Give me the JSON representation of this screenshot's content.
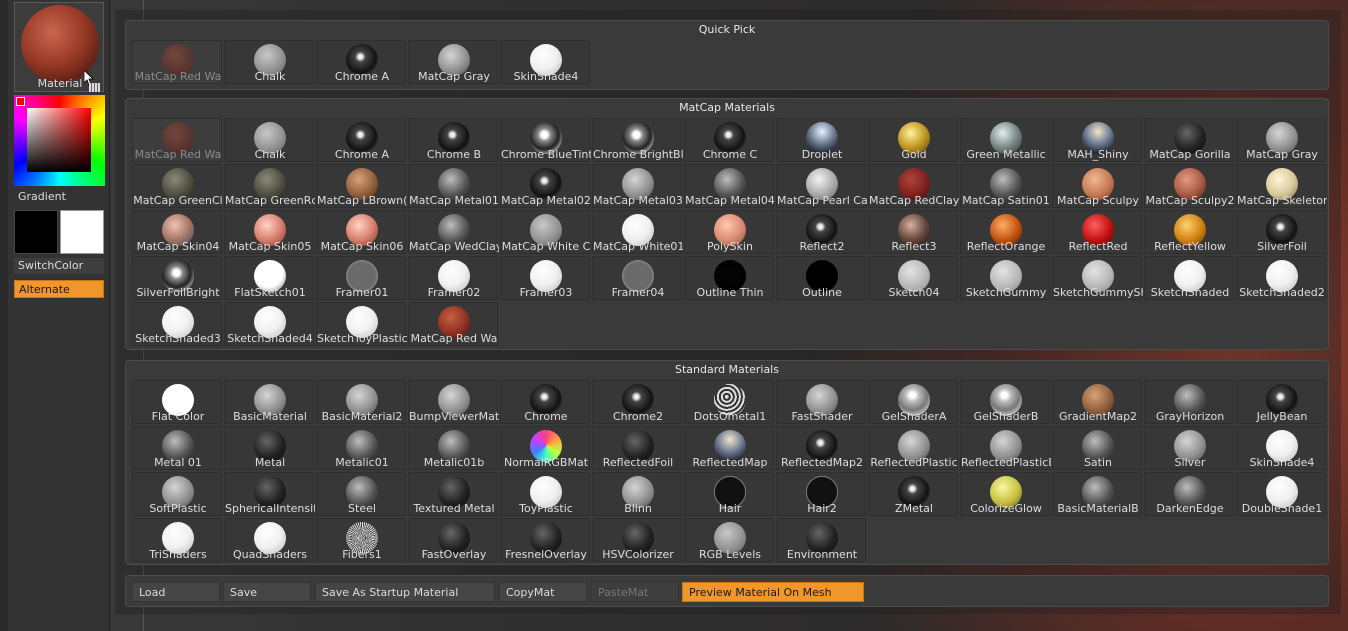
{
  "left_panel": {
    "material_label": "Material",
    "gradient_label": "Gradient",
    "switch_color": "SwitchColor",
    "alternate": "Alternate"
  },
  "colors": {
    "accent": "#f0962a",
    "panel_bg": "#3a3a3a"
  },
  "quick_pick": {
    "title": "Quick Pick",
    "items": [
      {
        "name": "MatCap Red Wax",
        "label": "MatCap Red Wa",
        "style": "redwax",
        "dim": true
      },
      {
        "name": "Chalk",
        "label": "Chalk",
        "style": "chalk"
      },
      {
        "name": "Chrome A",
        "label": "Chrome A",
        "style": "chrome"
      },
      {
        "name": "MatCap Gray",
        "label": "MatCap Gray",
        "style": "gray"
      },
      {
        "name": "SkinShade4",
        "label": "SkinShade4",
        "style": "white"
      }
    ]
  },
  "matcap": {
    "title": "MatCap Materials",
    "items": [
      {
        "label": "MatCap Red Wa",
        "style": "redwax",
        "dim": true
      },
      {
        "label": "Chalk",
        "style": "chalk"
      },
      {
        "label": "Chrome A",
        "style": "chrome"
      },
      {
        "label": "Chrome B",
        "style": "chrome"
      },
      {
        "label": "Chrome BlueTint",
        "style": "chromebright"
      },
      {
        "label": "Chrome BrightBl",
        "style": "chromebright"
      },
      {
        "label": "Chrome C",
        "style": "chrome"
      },
      {
        "label": "Droplet",
        "style": "droplet"
      },
      {
        "label": "Gold",
        "style": "gold"
      },
      {
        "label": "Green Metallic",
        "style": "greenmetal"
      },
      {
        "label": "MAH_Shiny",
        "style": "mahshiny"
      },
      {
        "label": "MatCap Gorilla",
        "style": "dark"
      },
      {
        "label": "MatCap Gray",
        "style": "gray"
      },
      {
        "label": "MatCap GreenCl",
        "style": "greenclay"
      },
      {
        "label": "MatCap GreenRc",
        "style": "greenclay"
      },
      {
        "label": "MatCap LBrown(",
        "style": "lbrown"
      },
      {
        "label": "MatCap Metal01",
        "style": "metal"
      },
      {
        "label": "MatCap Metal02",
        "style": "chrome"
      },
      {
        "label": "MatCap Metal03",
        "style": "gray"
      },
      {
        "label": "MatCap Metal04",
        "style": "metal"
      },
      {
        "label": "MatCap Pearl Ca",
        "style": "pearl"
      },
      {
        "label": "MatCap RedClay",
        "style": "redclay"
      },
      {
        "label": "MatCap Satin01",
        "style": "metal"
      },
      {
        "label": "MatCap Sculpy",
        "style": "sculpy"
      },
      {
        "label": "MatCap Sculpy2",
        "style": "sculpy2"
      },
      {
        "label": "MatCap Skeletor",
        "style": "skeleton"
      },
      {
        "label": "MatCap Skin04",
        "style": "skin04"
      },
      {
        "label": "MatCap Skin05",
        "style": "skin05"
      },
      {
        "label": "MatCap Skin06",
        "style": "skin05"
      },
      {
        "label": "MatCap WedClay",
        "style": "metal"
      },
      {
        "label": "MatCap White C",
        "style": "chalk"
      },
      {
        "label": "MatCap White01",
        "style": "white"
      },
      {
        "label": "PolySkin",
        "style": "polyskin"
      },
      {
        "label": "Reflect2",
        "style": "chrome"
      },
      {
        "label": "Reflect3",
        "style": "reflect3"
      },
      {
        "label": "ReflectOrange",
        "style": "orange"
      },
      {
        "label": "ReflectRed",
        "style": "red"
      },
      {
        "label": "ReflectYellow",
        "style": "yellow"
      },
      {
        "label": "SilverFoil",
        "style": "chrome"
      },
      {
        "label": "SilverFoilBright",
        "style": "chromebright"
      },
      {
        "label": "FlatSketch01",
        "style": "flatsketch"
      },
      {
        "label": "Framer01",
        "style": "framer"
      },
      {
        "label": "Framer02",
        "style": "white"
      },
      {
        "label": "Framer03",
        "style": "white"
      },
      {
        "label": "Framer04",
        "style": "framer"
      },
      {
        "label": "Outline Thin",
        "style": "black"
      },
      {
        "label": "Outline",
        "style": "outline"
      },
      {
        "label": "Sketch04",
        "style": "sketch"
      },
      {
        "label": "SketchGummy",
        "style": "sketch"
      },
      {
        "label": "SketchGummySh",
        "style": "sketch"
      },
      {
        "label": "SketchShaded",
        "style": "white"
      },
      {
        "label": "SketchShaded2",
        "style": "white"
      },
      {
        "label": "SketchShaded3",
        "style": "white"
      },
      {
        "label": "SketchShaded4",
        "style": "white"
      },
      {
        "label": "SketchToyPlastic",
        "style": "white"
      },
      {
        "label": "MatCap Red Wa",
        "style": "redwaxfull"
      }
    ]
  },
  "standard": {
    "title": "Standard Materials",
    "items": [
      {
        "label": "Flat Color",
        "style": "flatwhite"
      },
      {
        "label": "BasicMaterial",
        "style": "gray"
      },
      {
        "label": "BasicMaterial2",
        "style": "gray"
      },
      {
        "label": "BumpViewerMat",
        "style": "gray"
      },
      {
        "label": "Chrome",
        "style": "chrome"
      },
      {
        "label": "Chrome2",
        "style": "chrome"
      },
      {
        "label": "DotsOmetal1",
        "style": "dots"
      },
      {
        "label": "FastShader",
        "style": "gray"
      },
      {
        "label": "GelShaderA",
        "style": "gel"
      },
      {
        "label": "GelShaderB",
        "style": "gel"
      },
      {
        "label": "GradientMap2",
        "style": "lbrown"
      },
      {
        "label": "GrayHorizon",
        "style": "metal"
      },
      {
        "label": "JellyBean",
        "style": "chrome"
      },
      {
        "label": "Metal 01",
        "style": "metal"
      },
      {
        "label": "Metal",
        "style": "dark"
      },
      {
        "label": "Metalic01",
        "style": "metal"
      },
      {
        "label": "Metalic01b",
        "style": "metal"
      },
      {
        "label": "NormalRGBMat",
        "style": "normal"
      },
      {
        "label": "ReflectedFoil",
        "style": "dark"
      },
      {
        "label": "ReflectedMap",
        "style": "mahshiny"
      },
      {
        "label": "ReflectedMap2",
        "style": "chrome"
      },
      {
        "label": "ReflectedPlastic",
        "style": "gray"
      },
      {
        "label": "ReflectedPlasticE",
        "style": "gray"
      },
      {
        "label": "Satin",
        "style": "metal"
      },
      {
        "label": "Silver",
        "style": "gray"
      },
      {
        "label": "SkinShade4",
        "style": "white"
      },
      {
        "label": "SoftPlastic",
        "style": "gray"
      },
      {
        "label": "SphericalIntensit",
        "style": "dark"
      },
      {
        "label": "Steel",
        "style": "metal"
      },
      {
        "label": "Textured Metal",
        "style": "dark"
      },
      {
        "label": "ToyPlastic",
        "style": "white"
      },
      {
        "label": "Blinn",
        "style": "gray"
      },
      {
        "label": "Hair",
        "style": "hair"
      },
      {
        "label": "Hair2",
        "style": "hair"
      },
      {
        "label": "ZMetal",
        "style": "chrome"
      },
      {
        "label": "ColorizeGlow",
        "style": "yellowglow"
      },
      {
        "label": "BasicMaterialB",
        "style": "metal"
      },
      {
        "label": "DarkenEdge",
        "style": "metal"
      },
      {
        "label": "DoubleShade1",
        "style": "white"
      },
      {
        "label": "TriShaders",
        "style": "white"
      },
      {
        "label": "QuadShaders",
        "style": "white"
      },
      {
        "label": "Fibers1",
        "style": "fibers"
      },
      {
        "label": "FastOverlay",
        "style": "dark"
      },
      {
        "label": "FresnelOverlay",
        "style": "dark"
      },
      {
        "label": "HSVColorizer",
        "style": "dark"
      },
      {
        "label": "RGB Levels",
        "style": "chalk"
      },
      {
        "label": "Environment",
        "style": "dark"
      }
    ]
  },
  "toolbar": {
    "load": "Load",
    "save": "Save",
    "save_startup": "Save As Startup Material",
    "copymat": "CopyMat",
    "pastemat": "PasteMat",
    "preview": "Preview Material On Mesh"
  }
}
